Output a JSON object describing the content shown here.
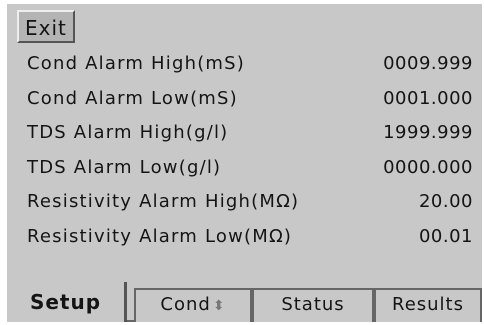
{
  "toolbar": {
    "exit_label": "Exit"
  },
  "alarms": [
    {
      "label": "Cond Alarm High(mS)",
      "value": "0009.999"
    },
    {
      "label": "Cond Alarm Low(mS)",
      "value": "0001.000"
    },
    {
      "label": "TDS Alarm High(g/l)",
      "value": "1999.999"
    },
    {
      "label": "TDS Alarm Low(g/l)",
      "value": "0000.000"
    },
    {
      "label": "Resistivity Alarm High(MΩ)",
      "value": "20.00"
    },
    {
      "label": "Resistivity Alarm Low(MΩ)",
      "value": "00.01"
    }
  ],
  "tabs": {
    "setup": "Setup",
    "cond": "Cond",
    "cond_icon": "up-down-arrows-icon",
    "status": "Status",
    "results": "Results"
  },
  "colors": {
    "screen_background": "#c8c8c8",
    "button_face": "#b4b4b4",
    "text": "#141414"
  }
}
